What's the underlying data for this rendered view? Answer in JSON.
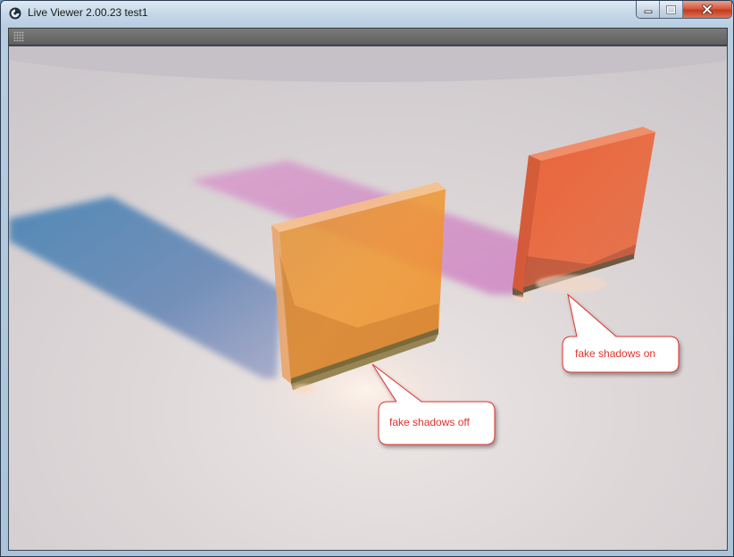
{
  "window": {
    "title": "Live Viewer 2.00.23 test1",
    "app_icon": "cinema4d-icon"
  },
  "caption_buttons": {
    "minimize_icon": "minimize-icon",
    "maximize_icon": "maximize-icon",
    "close_icon": "close-icon"
  },
  "toolbar": {
    "grip_icon": "grip-icon"
  },
  "viewport": {
    "callout_off": "fake shadows off",
    "callout_on": "fake shadows on"
  },
  "colors": {
    "callout_text": "#e0332b",
    "callout_border": "#e0332b",
    "floor": "#d6d1d2",
    "toolbar": "#6b6b6b"
  }
}
